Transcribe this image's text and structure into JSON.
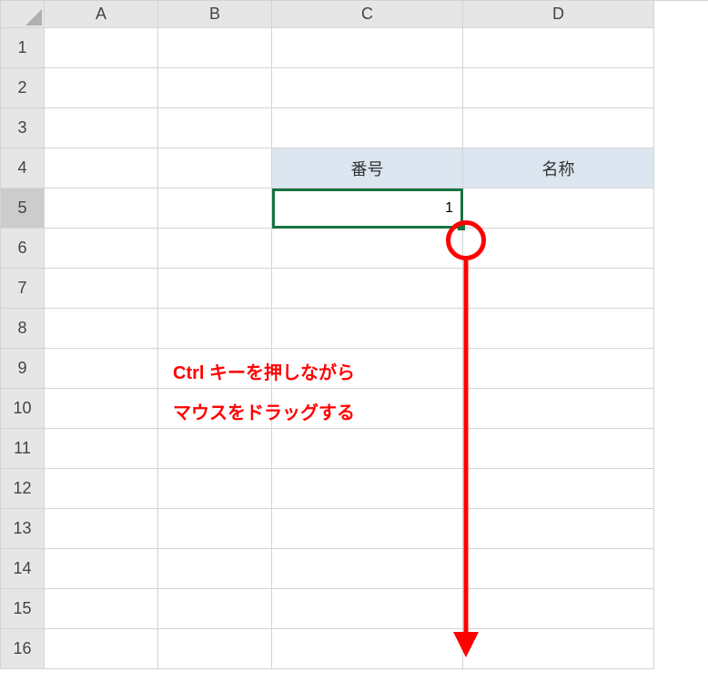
{
  "columns": [
    "A",
    "B",
    "C",
    "D"
  ],
  "rows": [
    "1",
    "2",
    "3",
    "4",
    "5",
    "6",
    "7",
    "8",
    "9",
    "10",
    "11",
    "12",
    "13",
    "14",
    "15",
    "16"
  ],
  "headers": {
    "c4": "番号",
    "d4": "名称"
  },
  "cells": {
    "c5": "1"
  },
  "selected_row": "5",
  "annotation": {
    "line1": "Ctrl キーを押しながら",
    "line2": "マウスをドラッグする"
  }
}
